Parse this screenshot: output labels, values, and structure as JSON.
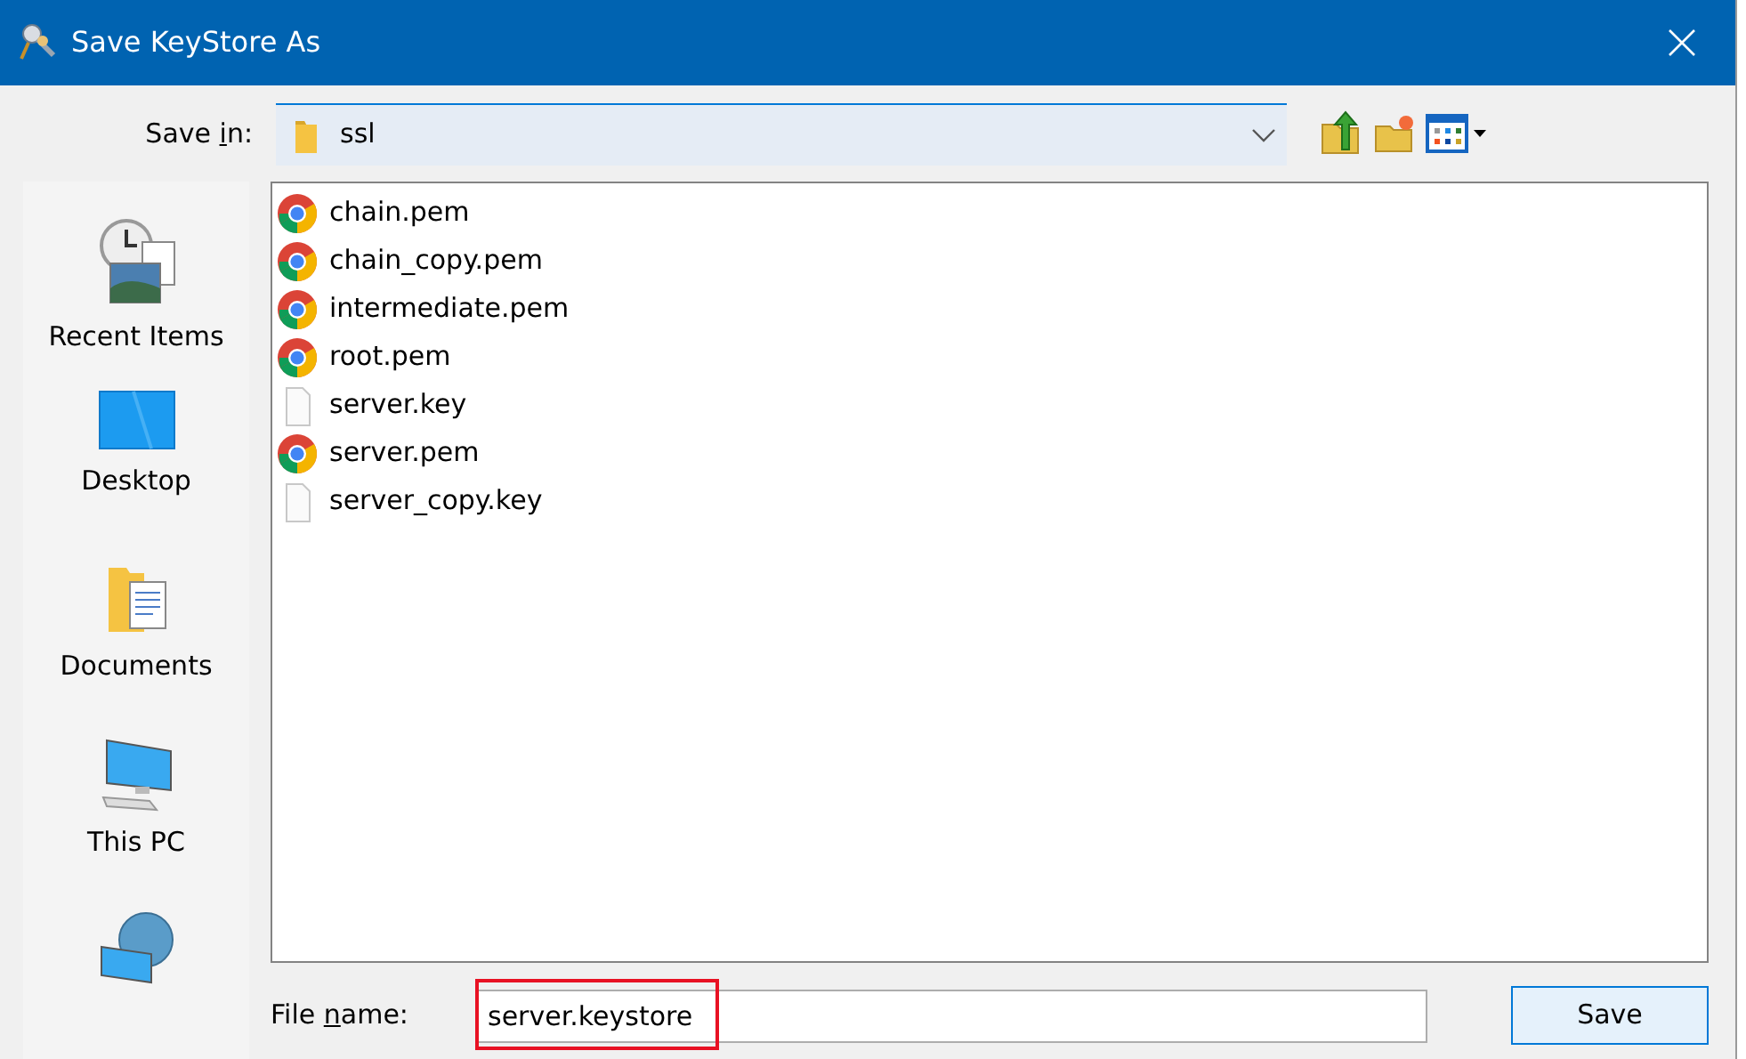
{
  "window": {
    "title": "Save KeyStore As"
  },
  "save_in": {
    "label_parts": [
      "Save ",
      "i",
      "n:"
    ],
    "value": "ssl"
  },
  "sidebar": {
    "items": [
      {
        "kind": "recent",
        "label": "Recent Items"
      },
      {
        "kind": "desktop",
        "label": "Desktop"
      },
      {
        "kind": "documents",
        "label": "Documents"
      },
      {
        "kind": "computer",
        "label": "This PC"
      },
      {
        "kind": "network"
      }
    ]
  },
  "files": [
    {
      "kind": "pem",
      "name": "chain.pem"
    },
    {
      "kind": "pem",
      "name": "chain_copy.pem"
    },
    {
      "kind": "pem",
      "name": "intermediate.pem"
    },
    {
      "kind": "pem",
      "name": "root.pem"
    },
    {
      "kind": "blank",
      "name": "server.key"
    },
    {
      "kind": "pem",
      "name": "server.pem"
    },
    {
      "kind": "blank",
      "name": "server_copy.key"
    }
  ],
  "file_name": {
    "label_parts": [
      "File ",
      "n",
      "ame:"
    ],
    "value": "server.keystore",
    "highlighted": true
  },
  "buttons": [
    {
      "kind": "primary",
      "label": "Save"
    }
  ]
}
